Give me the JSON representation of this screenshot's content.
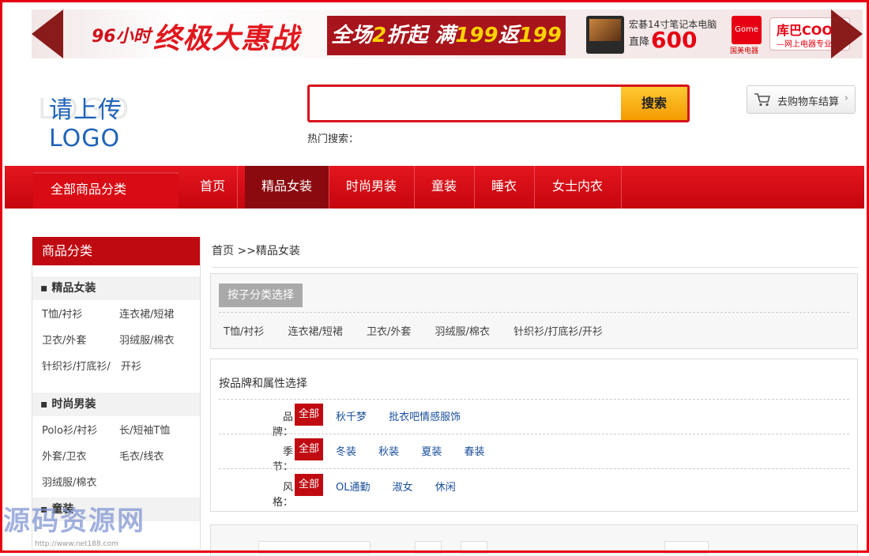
{
  "banner": {
    "hours": "96小时",
    "slogan": "终极大惠战",
    "promo_a": "全场",
    "promo_b": "2",
    "promo_c": "折起 满",
    "promo_d": "199",
    "promo_e": "返",
    "promo_f": "199",
    "laptop_title": "宏碁14寸笔记本电脑",
    "laptop_price_label": "直降",
    "laptop_price": "600",
    "gome": "Gome",
    "gome_sub": "国美电器",
    "coo8": "库巴COO8",
    "coo8_sub": "—网上电器专业库—"
  },
  "header": {
    "logo_text": "请上传 LOGO",
    "logo_ghost": "LOGO",
    "search_placeholder": "",
    "search_button": "搜索",
    "hot_search_label": "热门搜索：",
    "cart_label": "去购物车结算",
    "cart_chevron": "›"
  },
  "nav": {
    "all_categories": "全部商品分类",
    "items": [
      "首页",
      "精品女装",
      "时尚男装",
      "童装",
      "睡衣",
      "女士内衣"
    ],
    "active_index": 1
  },
  "sidebar": {
    "title": "商品分类",
    "groups": [
      {
        "title": "精品女装",
        "links": [
          "T恤/衬衫",
          "连衣裙/短裙",
          "卫衣/外套",
          "羽绒服/棉衣",
          "针织衫/打底衫/",
          "开衫"
        ]
      },
      {
        "title": "时尚男装",
        "links": [
          "Polo衫/衬衫",
          "长/短袖T恤",
          "外套/卫衣",
          "毛衣/线衣",
          "羽绒服/棉衣"
        ]
      },
      {
        "title": "童装",
        "links": []
      }
    ]
  },
  "main": {
    "breadcrumb_home": "首页",
    "breadcrumb_sep": ">>",
    "breadcrumb_current": "精品女装",
    "subcat_title": "按子分类选择",
    "subcats": [
      "T恤/衬衫",
      "连衣裙/短裙",
      "卫衣/外套",
      "羽绒服/棉衣",
      "针织衫/打底衫/开衫"
    ],
    "attrs_title": "按品牌和属性选择",
    "attr_rows": [
      {
        "label": "品牌：",
        "all": "全部",
        "options": [
          "秋千梦",
          "批衣吧情感服饰"
        ]
      },
      {
        "label": "季节：",
        "all": "全部",
        "options": [
          "冬装",
          "秋装",
          "夏装",
          "春装"
        ]
      },
      {
        "label": "风格：",
        "all": "全部",
        "options": [
          "OL通勤",
          "淑女",
          "休闲"
        ]
      }
    ]
  },
  "watermark": {
    "text": "源码资源网",
    "url": "http://www.net188.com"
  },
  "colors": {
    "brand_red": "#e60012",
    "nav_active": "#8a0a0f",
    "search_button": "#f5a300",
    "link_blue": "#1a4f9c"
  }
}
